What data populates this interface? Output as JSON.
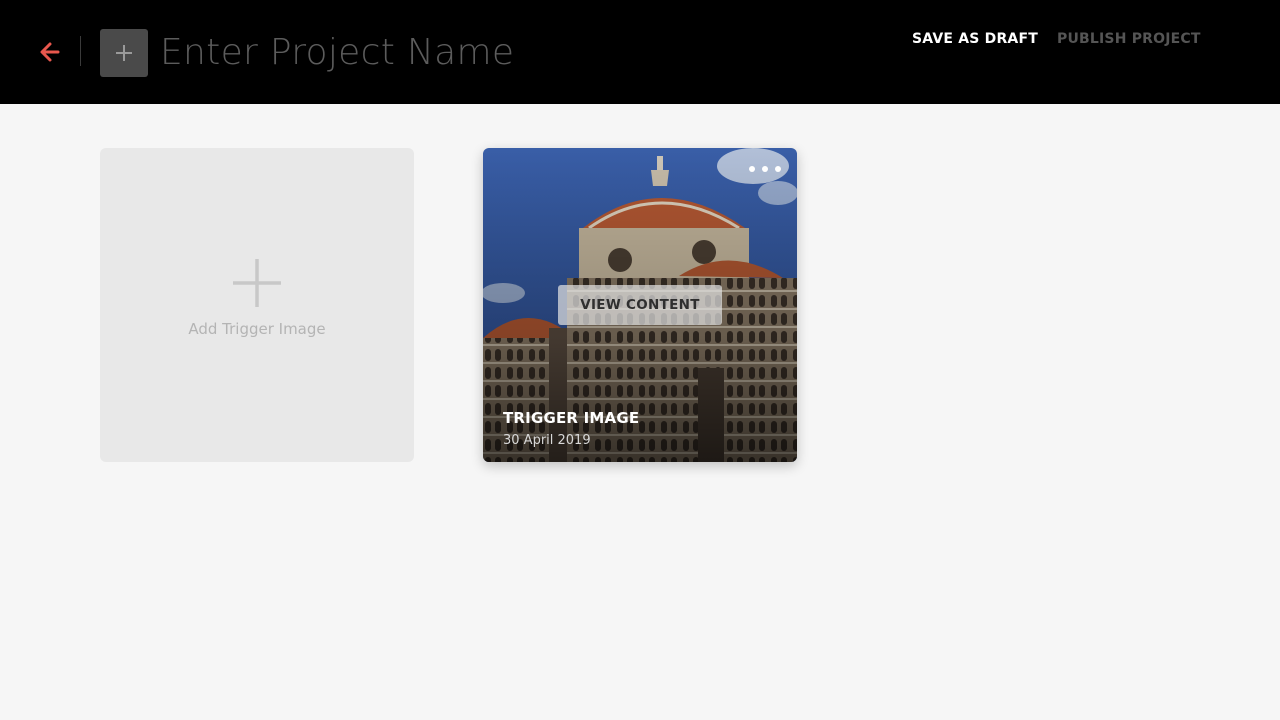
{
  "header": {
    "project_name_placeholder": "Enter Project Name",
    "project_name_value": "",
    "save_draft_label": "SAVE AS DRAFT",
    "publish_label": "PUBLISH PROJECT",
    "back_icon": "arrow-left-icon",
    "add_icon": "plus-icon"
  },
  "add_trigger": {
    "label": "Add Trigger Image",
    "icon": "plus-icon"
  },
  "trigger_card": {
    "title": "TRIGGER IMAGE",
    "date": "30 April 2019",
    "view_button_label": "VIEW CONTENT",
    "menu_icon": "more-horizontal-icon"
  },
  "colors": {
    "header_bg": "#000000",
    "accent_back": "#e8574d",
    "page_bg": "#f6f6f6",
    "card_placeholder_bg": "#e8e8e8",
    "publish_disabled": "#555555"
  }
}
